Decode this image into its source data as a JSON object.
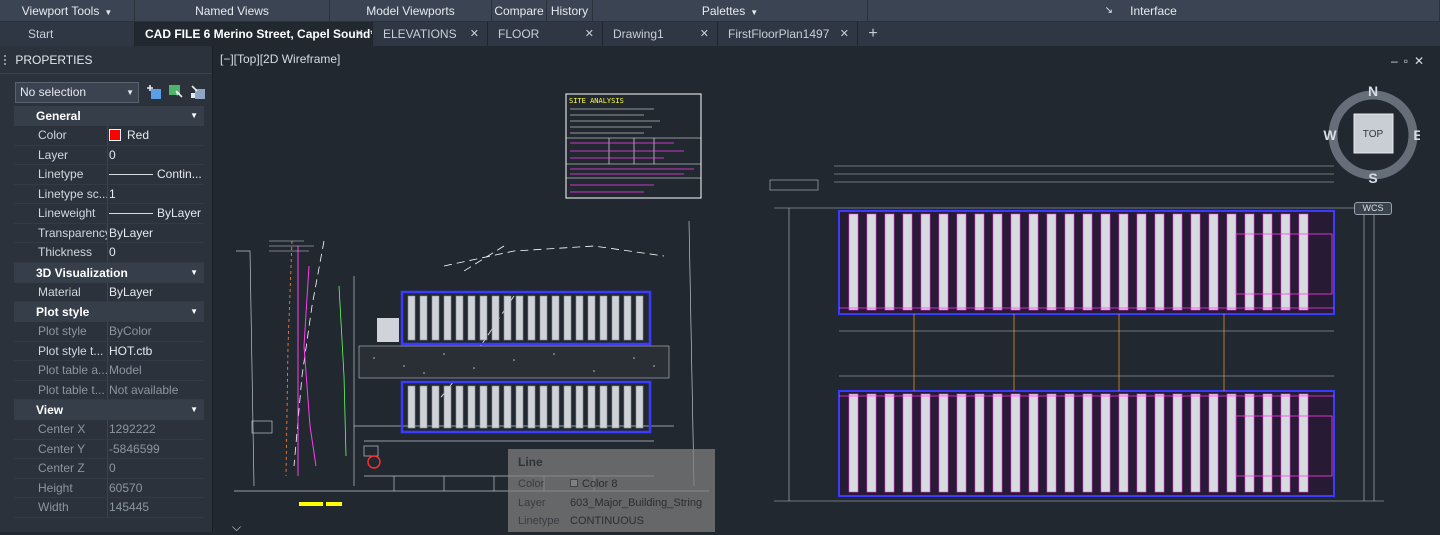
{
  "ribbon": {
    "panels": [
      {
        "label": "Viewport Tools",
        "dropdown": true,
        "width": 135
      },
      {
        "label": "Named Views",
        "dropdown": false,
        "width": 195
      },
      {
        "label": "Model Viewports",
        "dropdown": false,
        "width": 162
      },
      {
        "label": "Compare",
        "dropdown": false,
        "width": 55
      },
      {
        "label": "History",
        "dropdown": false,
        "width": 46
      },
      {
        "label": "Palettes",
        "dropdown": true,
        "width": 275
      },
      {
        "label": "Interface",
        "dropdown": false,
        "width": 572
      }
    ],
    "interface_arrow": "↘"
  },
  "tabs": {
    "items": [
      {
        "label": "Start",
        "closable": false,
        "active": false
      },
      {
        "label": "CAD FILE 6 Merino Street, Capel Sound*",
        "closable": true,
        "active": true
      },
      {
        "label": "ELEVATIONS",
        "closable": true,
        "active": false
      },
      {
        "label": "FLOOR",
        "closable": true,
        "active": false
      },
      {
        "label": "Drawing1",
        "closable": true,
        "active": false
      },
      {
        "label": "FirstFloorPlan1497",
        "closable": true,
        "active": false
      }
    ],
    "add_label": "+"
  },
  "properties": {
    "title": "PROPERTIES",
    "selection": "No selection",
    "sections": {
      "general": {
        "title": "General",
        "rows": {
          "color": {
            "key": "Color",
            "value": "Red",
            "swatch": "#ff0000"
          },
          "layer": {
            "key": "Layer",
            "value": "0"
          },
          "linetype": {
            "key": "Linetype",
            "value": "Contin..."
          },
          "linetype_scale": {
            "key": "Linetype sc...",
            "value": "1"
          },
          "lineweight": {
            "key": "Lineweight",
            "value": "ByLayer"
          },
          "transparency": {
            "key": "Transparency",
            "value": "ByLayer"
          },
          "thickness": {
            "key": "Thickness",
            "value": "0"
          }
        }
      },
      "visualization": {
        "title": "3D Visualization",
        "rows": {
          "material": {
            "key": "Material",
            "value": "ByLayer"
          }
        }
      },
      "plot": {
        "title": "Plot style",
        "rows": {
          "plot_style": {
            "key": "Plot style",
            "value": "ByColor"
          },
          "plot_style_table": {
            "key": "Plot style t...",
            "value": "HOT.ctb"
          },
          "plot_table_attached": {
            "key": "Plot table a...",
            "value": "Model"
          },
          "plot_table_type": {
            "key": "Plot table t...",
            "value": "Not available"
          }
        }
      },
      "view": {
        "title": "View",
        "rows": {
          "center_x": {
            "key": "Center X",
            "value": "1292222"
          },
          "center_y": {
            "key": "Center Y",
            "value": "-5846599"
          },
          "center_z": {
            "key": "Center Z",
            "value": "0"
          },
          "height": {
            "key": "Height",
            "value": "60570"
          },
          "width": {
            "key": "Width",
            "value": "145445"
          }
        }
      }
    }
  },
  "viewport": {
    "label": "[−][Top][2D Wireframe]",
    "controls": "–▫✕"
  },
  "viewcube": {
    "face": "TOP",
    "north": "N",
    "south": "S",
    "east": "E",
    "west": "W",
    "wcs": "WCS"
  },
  "tooltip": {
    "title": "Line",
    "color_key": "Color",
    "color_value": "Color 8",
    "layer_key": "Layer",
    "layer_value": "603_Major_Building_String",
    "linetype_key": "Linetype",
    "linetype_value": "CONTINUOUS"
  },
  "drawing": {
    "site_analysis_title": "SITE ANALYSIS"
  },
  "colors": {
    "background": "#212830",
    "magenta": "#ff3cf0",
    "blue": "#3b3bff",
    "white": "#ffffff"
  }
}
